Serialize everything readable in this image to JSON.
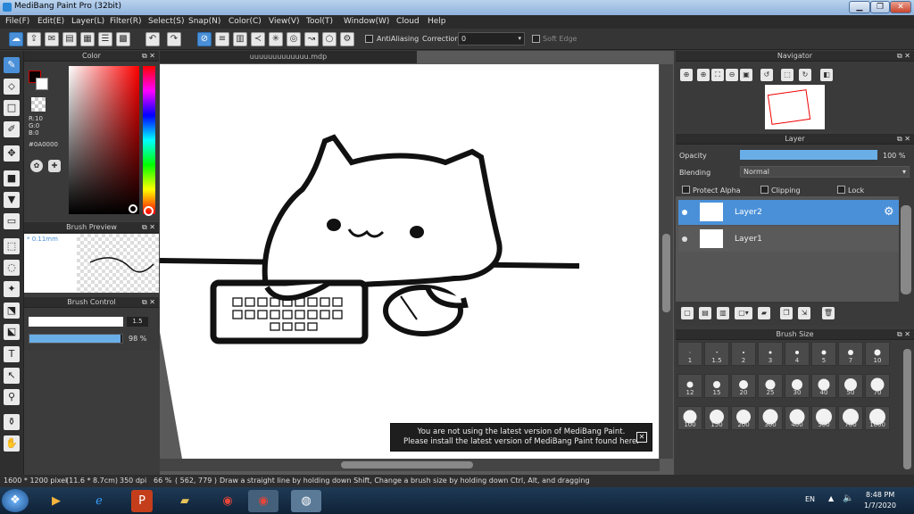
{
  "window": {
    "title": "MediBang Paint Pro (32bit)",
    "minimize_label": "▁",
    "maximize_label": "❐",
    "close_label": "✕"
  },
  "menu": [
    "File(F)",
    "Edit(E)",
    "Layer(L)",
    "Filter(R)",
    "Select(S)",
    "Snap(N)",
    "Color(C)",
    "View(V)",
    "Tool(T)",
    "Window(W)",
    "Cloud",
    "Help"
  ],
  "toolbar": {
    "antialiasing_label": "AntiAliasing",
    "correction_label": "Correction",
    "correction_value": "0",
    "soft_edge_label": "Soft Edge"
  },
  "color_panel": {
    "title": "Color",
    "r_label": "R:10",
    "g_label": "G:0",
    "b_label": "B:0",
    "hex": "#0A0000",
    "fg_color": "#0a0000",
    "bg_color": "#ffffff"
  },
  "brush_preview": {
    "title": "Brush Preview",
    "size_text": "* 0.11mm"
  },
  "brush_control": {
    "title": "Brush Control",
    "size_value": "1.5",
    "opacity_value": "98 %",
    "size_fraction": 0.15,
    "opacity_fraction": 0.98
  },
  "document": {
    "tab_title": "uuuuuuuuuuuuu.mdp"
  },
  "notice": {
    "line1": "You are not using the latest version of MediBang Paint.",
    "line2": "Please install the latest version of MediBang Paint found here.",
    "close_label": "✕"
  },
  "navigator": {
    "title": "Navigator"
  },
  "layer_panel": {
    "title": "Layer",
    "opacity_label": "Opacity",
    "opacity_value": "100 %",
    "opacity_fraction": 1.0,
    "blending_label": "Blending",
    "blending_value": "Normal",
    "protect_alpha_label": "Protect Alpha",
    "clipping_label": "Clipping",
    "lock_label": "Lock",
    "layers": [
      {
        "name": "Layer2",
        "selected": true
      },
      {
        "name": "Layer1",
        "selected": false
      }
    ]
  },
  "brush_size": {
    "title": "Brush Size",
    "sizes": [
      "1",
      "1.5",
      "2",
      "3",
      "4",
      "5",
      "7",
      "10",
      "12",
      "15",
      "20",
      "25",
      "30",
      "40",
      "50",
      "70",
      "100",
      "150",
      "200",
      "300",
      "400",
      "500",
      "700",
      "1000"
    ]
  },
  "status": {
    "dimensions": "1600 * 1200 pixel",
    "physical": "(11.6 * 8.7cm)",
    "dpi": "350 dpi",
    "zoom": "66 %",
    "coords": "( 562, 779 )",
    "hint": "Draw a straight line by holding down Shift, Change a brush size by holding down Ctrl, Alt, and dragging"
  },
  "taskbar": {
    "lang": "EN",
    "time": "8:48 PM",
    "date": "1/7/2020"
  },
  "colors": {
    "accent": "#4a90d8",
    "panel": "#3a3a3a"
  }
}
